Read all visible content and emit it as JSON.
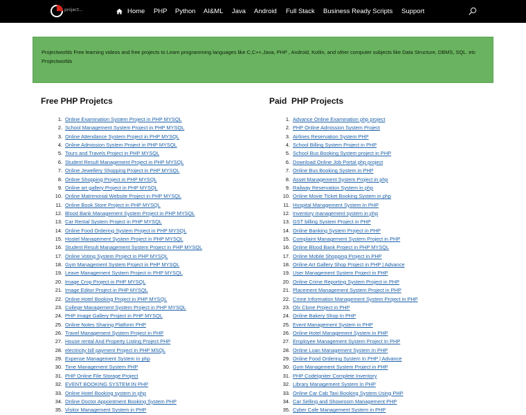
{
  "header": {
    "logo_text": "project...",
    "nav": [
      "Home",
      "PHP",
      "Python",
      "AI&ML",
      "Java",
      "Android",
      "Full Stack",
      "Business Ready Scripts",
      "Support"
    ]
  },
  "banner": {
    "text": "Projectworlds Free learning videos and free projects to Learn programming languages like C,C++,Java, PHP , Android, Kotlin, and other computer subjects like Data Structure, DBMS, SQL. etc",
    "sub": "Projectworlds"
  },
  "free": {
    "title": "Free PHP Projetcs",
    "items": [
      "Online Examination System Project in PHP MYSQL",
      "School Management System Project in PHP MYSQL",
      "Online Attendance System Project in PHP MYSQL",
      "Online Admission System Project in PHP MYSQL",
      "Tours and Travels Project in PHP MYSQL",
      "Student Result Management Project in PHP MYSQL",
      "Online Jewellery Shopping Project in PHP MYSQL",
      "Online Shopping Project in PHP MYSQL",
      "Online art gallery Project in PHP MYSQL",
      "Online Matrimonial Website Project in PHP MYSQL",
      "Online Book Store Project in PHP MYSQL",
      "Blood Bank Management System Project in PHP MYSQL",
      "Car Rental System Project in PHP MYSQL",
      "Online Food Ordering System Project in PHP MYSQL",
      "Hostel Management System Project in PHP MYSQL",
      "Student Result Management System Project in PHP MYSQL",
      "Online Voting System Project in PHP MYSQL",
      "Gym Management System Project in PHP MYSQL",
      "Leave Management System Project in PHP MYSQL",
      "Image Crop Project in PHP MYSQL",
      "Image Editor Project in PHP MYSQL",
      "Online Hotel Booking Project in PHP MYSQL",
      "College Management System Project in PHP MYSQL",
      "PHP Image Gallery Project in PHP MYSQL",
      "Online Notes Sharing Platform PHP",
      "Travel Management System Project in PHP",
      "House rental And Property Listing Project PHP",
      "electricity bill payment Project in PHP MSQL",
      "Expense Management System in php",
      "Time Management System PHP",
      "PHP Online File Storage Project",
      "EVENT BOOKING SYSTEM IN PHP",
      "Online Hotel Booking system in php",
      "Online Doctor Appointment Booking System PHP",
      "Visitor Management System in PHP"
    ]
  },
  "paid": {
    "title": "Paid  PHP Projects",
    "items": [
      "Advance Online Examination php project",
      "PHP Online Admission System Project",
      "Airlines Reservation System PHP",
      "School Billing System Project in PHP",
      "School Bus Booking System project in PHP",
      "Download Online Job Portal php project",
      "Online Bus Booking System in PHP",
      "Asset Management System Project in php",
      "Railway Reservation System in php",
      "Online Movie Ticket Booking System in php",
      "Hospital Management System In PHP",
      "Inventory management system in php",
      "GST billing System Project in PHP",
      "Online Banking System Project in PHP",
      "Complaint Management System Project in PHP",
      "Online Blood Bank Project in PHP MYSQL",
      "Online Mobile Shopping Project in PHP",
      "Online Art Gallery Shop Project in PHP | Advance",
      "User Management System Project in PHP",
      "Online Crime Reporting System Project in PHP",
      "Placement Management System Project in PHP",
      "Crime Information Management System Project in PHP",
      "Olx Clone Project in PHP",
      "Online Bakery Shop In PHP",
      "Event Management System in PHP",
      "Online Hotel Management System in PHP",
      "Employee Management System Project In PHP",
      "Online Loan Management System In PHP",
      "Online Food Ordering System In PHP | Advance",
      "Gym Management System Project in PHP",
      "PHP CodeIgniter Complete Inventory",
      "Library Management System In PHP",
      "Online Car Cab Taxi Booking System Using PHP",
      "Car Selling and Showroom Management  PHP",
      "Cyber Cafe Management System in PHP"
    ]
  }
}
